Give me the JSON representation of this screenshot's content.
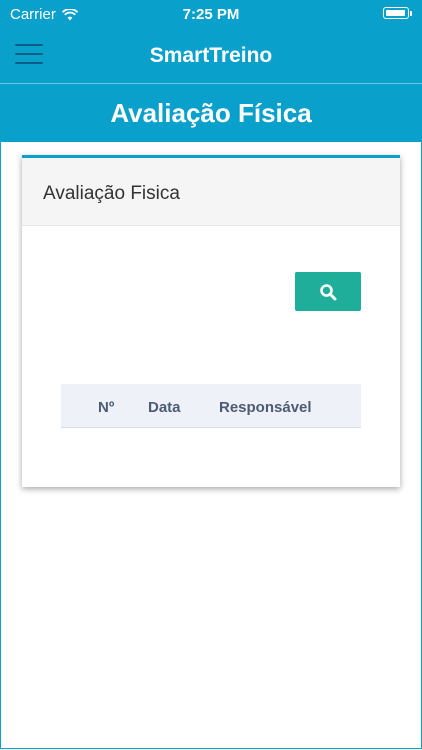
{
  "status_bar": {
    "carrier": "Carrier",
    "time": "7:25 PM",
    "icons": [
      "wifi-icon",
      "battery-icon"
    ]
  },
  "nav": {
    "title": "SmartTreino",
    "menu_icon": "hamburger-menu-icon"
  },
  "page": {
    "title": "Avaliação Física"
  },
  "card": {
    "title": "Avaliação Fisica",
    "search_icon": "search-icon",
    "table": {
      "columns": [
        "Nº",
        "Data",
        "Responsável"
      ],
      "rows": []
    }
  },
  "colors": {
    "primary": "#0aa0cc",
    "search_button": "#1fae9a",
    "table_header_bg": "#eef2f8",
    "table_header_text": "#4e5b76"
  }
}
